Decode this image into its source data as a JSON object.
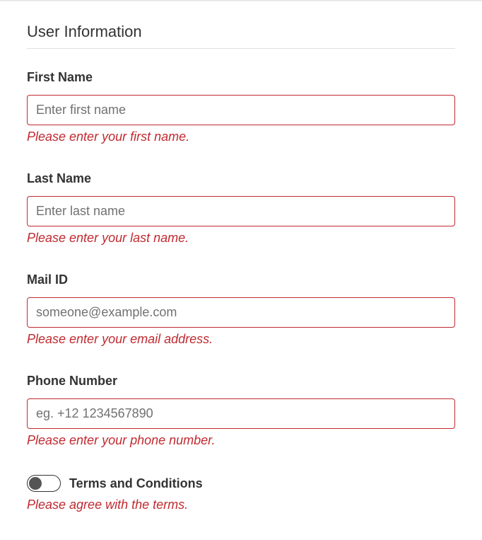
{
  "form": {
    "section_title": "User Information",
    "fields": {
      "first_name": {
        "label": "First Name",
        "placeholder": "Enter first name",
        "value": "",
        "error": "Please enter your first name."
      },
      "last_name": {
        "label": "Last Name",
        "placeholder": "Enter last name",
        "value": "",
        "error": "Please enter your last name."
      },
      "mail_id": {
        "label": "Mail ID",
        "placeholder": "someone@example.com",
        "value": "",
        "error": "Please enter your email address."
      },
      "phone_number": {
        "label": "Phone Number",
        "placeholder": "eg. +12 1234567890",
        "value": "",
        "error": "Please enter your phone number."
      },
      "terms": {
        "label": "Terms and Conditions",
        "checked": false,
        "error": "Please agree with the terms."
      }
    }
  }
}
